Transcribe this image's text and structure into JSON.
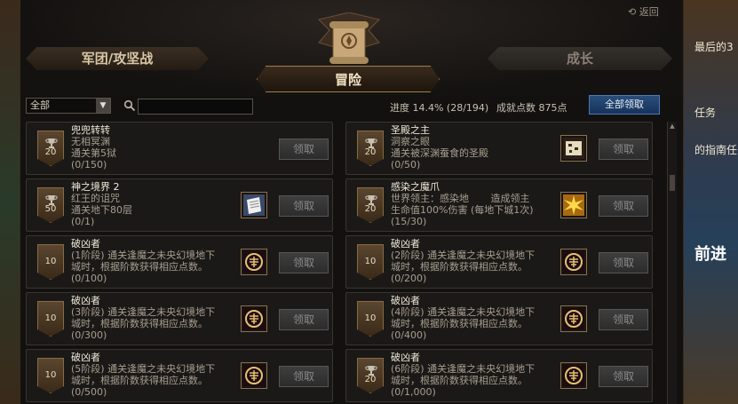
{
  "header": {
    "back_label": "返回",
    "tabs": {
      "left": "军团/攻坚战",
      "center": "冒险",
      "right": "成长"
    }
  },
  "toolbar": {
    "filter_value": "全部",
    "search_placeholder": "",
    "progress_text": "进度 14.4% (28/194)",
    "points_text": "成就点数 875点",
    "claim_all_label": "全部领取"
  },
  "cards": [
    {
      "points": "20",
      "trophy": true,
      "title": "兜兜转转",
      "lines": [
        "无相冥渊",
        "通关第5狱"
      ],
      "count": "(0/150)",
      "icon": "",
      "claim": "领取"
    },
    {
      "points": "20",
      "trophy": true,
      "title": "圣殿之主",
      "lines": [
        "洞察之眼",
        "通关被深渊蚕食的圣殿"
      ],
      "count": "(0/50)",
      "icon": "scroll-item-icon",
      "claim": "领取"
    },
    {
      "points": "50",
      "trophy": true,
      "title": "神之境界 2",
      "lines": [
        "红王的诅咒",
        "通关地下80层"
      ],
      "count": "(0/1)",
      "icon": "document-item-icon",
      "claim": "领取"
    },
    {
      "points": "20",
      "trophy": true,
      "title": "感染之魔爪",
      "lines": [
        "世界领主：感染地       造成领主",
        "生命值100%伤害 (每地下城1次)"
      ],
      "count": "(15/30)",
      "icon": "starburst-item-icon",
      "claim": "领取"
    },
    {
      "points": "10",
      "trophy": false,
      "title": "破凶者",
      "lines": [
        "(1阶段) 通关逢魔之未央幻境地下",
        "城时，根据阶数获得相应点数。"
      ],
      "count": "(0/100)",
      "icon": "emblem-item-icon",
      "claim": "领取"
    },
    {
      "points": "10",
      "trophy": false,
      "title": "破凶者",
      "lines": [
        "(2阶段) 通关逢魔之未央幻境地下",
        "城时，根据阶数获得相应点数。"
      ],
      "count": "(0/200)",
      "icon": "emblem-item-icon",
      "claim": "领取"
    },
    {
      "points": "10",
      "trophy": false,
      "title": "破凶者",
      "lines": [
        "(3阶段) 通关逢魔之未央幻境地下",
        "城时，根据阶数获得相应点数。"
      ],
      "count": "(0/300)",
      "icon": "emblem-item-icon",
      "claim": "领取"
    },
    {
      "points": "10",
      "trophy": false,
      "title": "破凶者",
      "lines": [
        "(4阶段) 通关逢魔之未央幻境地下",
        "城时，根据阶数获得相应点数。"
      ],
      "count": "(0/400)",
      "icon": "emblem-item-icon",
      "claim": "领取"
    },
    {
      "points": "10",
      "trophy": false,
      "title": "破凶者",
      "lines": [
        "(5阶段) 通关逢魔之未央幻境地下",
        "城时，根据阶数获得相应点数。"
      ],
      "count": "(0/500)",
      "icon": "emblem-item-icon",
      "claim": "领取"
    },
    {
      "points": "20",
      "trophy": true,
      "title": "破凶者",
      "lines": [
        "(6阶段) 通关逢魔之未央幻境地下",
        "城时，根据阶数获得相应点数。"
      ],
      "count": "(0/1,000)",
      "icon": "emblem-item-icon",
      "claim": "领取"
    }
  ],
  "side": {
    "t1": "最后的3",
    "t2": "任务",
    "t3": "的指南任",
    "t4": "前进"
  }
}
